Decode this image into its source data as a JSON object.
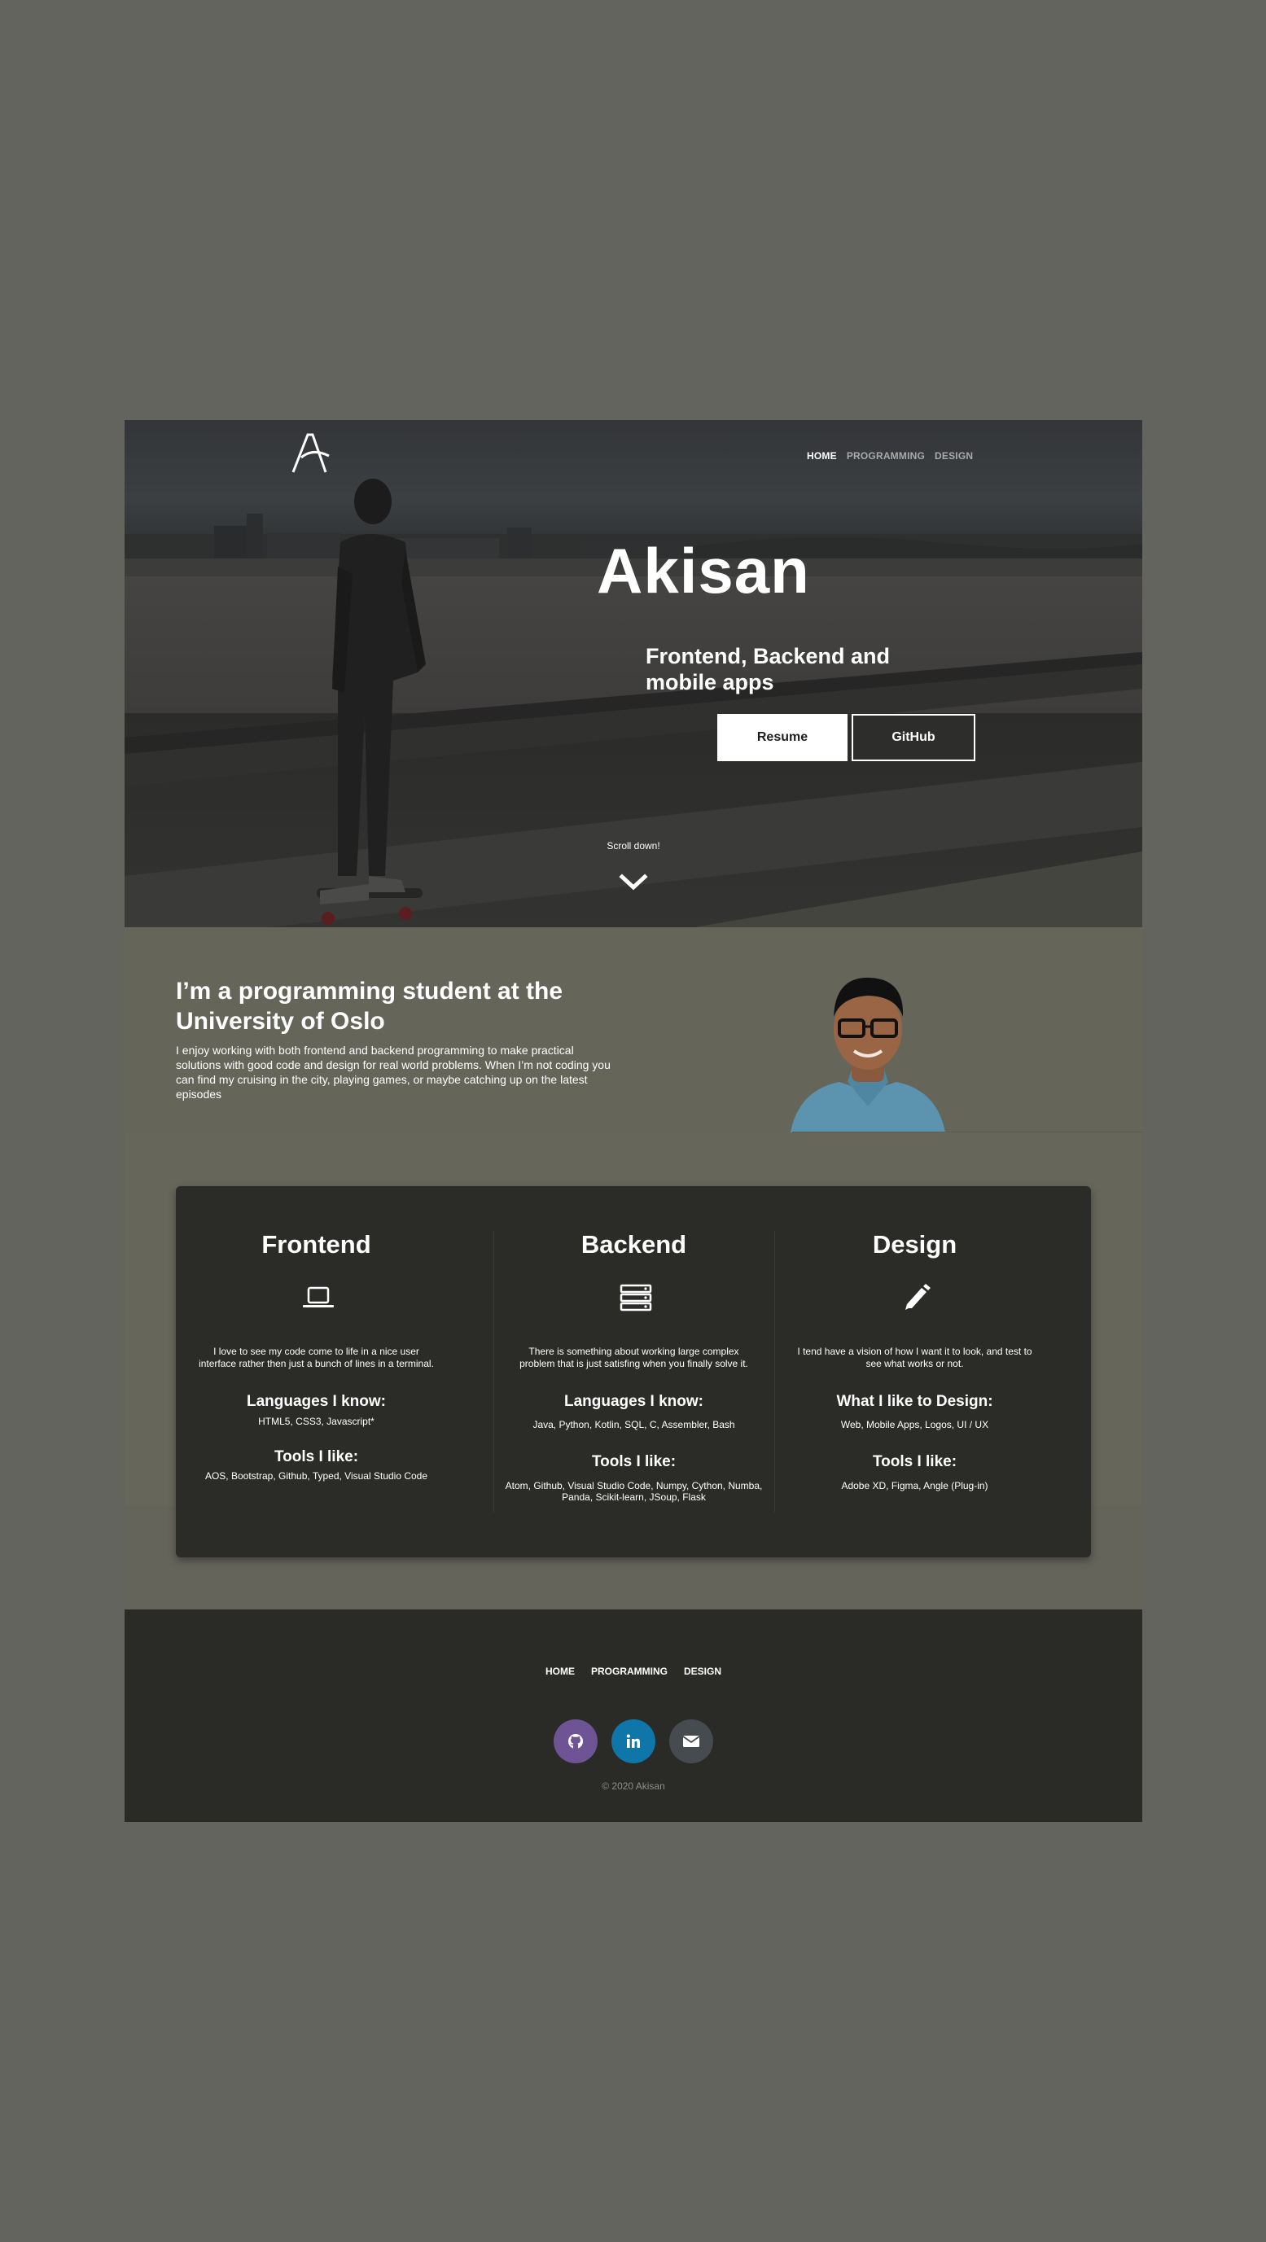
{
  "nav": {
    "items": [
      "HOME",
      "PROGRAMMING",
      "DESIGN"
    ]
  },
  "hero": {
    "title": "Akisan",
    "subtitle": "Frontend, Backend and mobile apps",
    "resume_label": "Resume",
    "github_label": "GitHub",
    "scroll_text": "Scroll down!"
  },
  "about": {
    "heading": "I’m a programming student at the University of Oslo",
    "text": "I enjoy working with both frontend and backend programming to make practical solutions with good code and design for real world problems. When I’m not coding you can find my cruising in the city, playing games, or maybe catching up on the latest episodes"
  },
  "skills": [
    {
      "title": "Frontend",
      "icon": "laptop-icon",
      "desc": "I love to see my code come to life in a nice user interface rather then just a bunch of lines in a terminal.",
      "h1": "Languages I know:",
      "v1": "HTML5, CSS3, Javascript*",
      "h2": "Tools I like:",
      "v2": "AOS, Bootstrap, Github, Typed, Visual Studio Code"
    },
    {
      "title": "Backend",
      "icon": "server-icon",
      "desc": "There is something about working large complex problem that is just satisfing when you finally solve it.",
      "h1": "Languages I know:",
      "v1": "Java, Python, Kotlin, SQL, C, Assembler, Bash",
      "h2": "Tools I like:",
      "v2": "Atom, Github, Visual Studio Code, Numpy, Cython, Numba, Panda, Scikit-learn, JSoup, Flask"
    },
    {
      "title": "Design",
      "icon": "pencil-icon",
      "desc": "I tend have a vision of how I want it to look, and test to see what works or not.",
      "h1": "What I like to Design:",
      "v1": "Web, Mobile Apps, Logos, UI / UX",
      "h2": "Tools I like:",
      "v2": "Adobe XD, Figma, Angle (Plug-in)"
    }
  ],
  "footer": {
    "nav": [
      "HOME",
      "PROGRAMMING",
      "DESIGN"
    ],
    "social": [
      {
        "icon": "github-icon",
        "color": "#6e5494"
      },
      {
        "icon": "linkedin-icon",
        "color": "#0e76a8"
      },
      {
        "icon": "mail-icon",
        "color": "#454b4f"
      }
    ],
    "copyright": "© 2020 Akisan"
  }
}
